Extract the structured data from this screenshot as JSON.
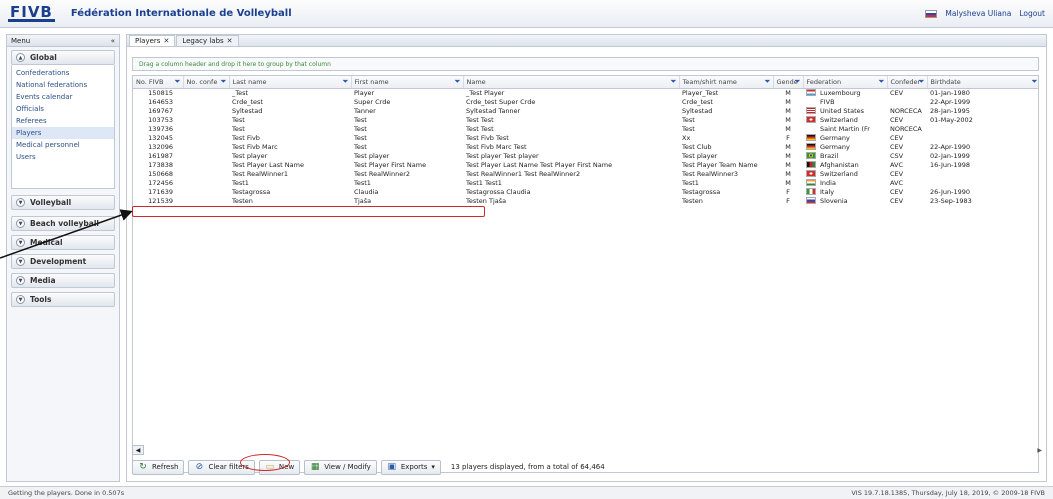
{
  "header": {
    "logo": "FIVB",
    "title": "Fédération Internationale de Volleyball",
    "user": "Malysheva Uliana",
    "logout": "Logout"
  },
  "sidebar": {
    "title": "Menu",
    "pin": "«",
    "global": {
      "label": "Global",
      "items": [
        "Confederations",
        "National federations",
        "Events calendar",
        "Officials",
        "Referees",
        "Players",
        "Medical personnel",
        "Users"
      ]
    },
    "sections": [
      "Volleyball",
      "Beach volleyball",
      "Medical",
      "Development",
      "Media",
      "Tools"
    ]
  },
  "tabs": [
    {
      "label": "Players"
    },
    {
      "label": "Legacy labs"
    }
  ],
  "group_bar": "Drag a column header and drop it here to group by that column",
  "columns": [
    "No. FIVB",
    "No. confe",
    "Last name",
    "First name",
    "Name",
    "Team/shirt name",
    "Gende",
    "Federation",
    "Confeder",
    "Birthdate"
  ],
  "rows": [
    {
      "no": "150815",
      "conf": "",
      "last": "_Test",
      "first": "Player",
      "name": "_Test Player",
      "team": "Player_Test",
      "gender": "M",
      "fed": "Luxembourg",
      "flag": "lux",
      "confed": "CEV",
      "birth": "01-Jan-1980"
    },
    {
      "no": "164653",
      "conf": "",
      "last": "Crde_test",
      "first": "Super Crde",
      "name": "Crde_test Super Crde",
      "team": "Crde_test",
      "gender": "M",
      "fed": "FIVB",
      "flag": "",
      "confed": "",
      "birth": "22-Apr-1999"
    },
    {
      "no": "169767",
      "conf": "",
      "last": "Syltestad",
      "first": "Tanner",
      "name": "Syltestad Tanner",
      "team": "Syltestad",
      "gender": "M",
      "fed": "United States",
      "flag": "usa",
      "confed": "NORCECA",
      "birth": "28-Jan-1995"
    },
    {
      "no": "103753",
      "conf": "",
      "last": "Test",
      "first": "Test",
      "name": "Test Test",
      "team": "Test",
      "gender": "M",
      "fed": "Switzerland",
      "flag": "sui",
      "confed": "CEV",
      "birth": "01-May-2002"
    },
    {
      "no": "139736",
      "conf": "",
      "last": "Test",
      "first": "Test",
      "name": "Test Test",
      "team": "Test",
      "gender": "M",
      "fed": "Saint Martin (Fr",
      "flag": "",
      "confed": "NORCECA",
      "birth": ""
    },
    {
      "no": "132045",
      "conf": "",
      "last": "Test Fivb",
      "first": "Test",
      "name": "Test Fivb Test",
      "team": "Xx",
      "gender": "F",
      "fed": "Germany",
      "flag": "ger",
      "confed": "CEV",
      "birth": ""
    },
    {
      "no": "132096",
      "conf": "",
      "last": "Test Fivb Marc",
      "first": "Test",
      "name": "Test Fivb Marc Test",
      "team": "Test Club",
      "gender": "M",
      "fed": "Germany",
      "flag": "ger",
      "confed": "CEV",
      "birth": "22-Apr-1990"
    },
    {
      "no": "161987",
      "conf": "",
      "last": "Test player",
      "first": "Test player",
      "name": "Test player Test player",
      "team": "Test player",
      "gender": "M",
      "fed": "Brazil",
      "flag": "bra",
      "confed": "CSV",
      "birth": "02-Jan-1999"
    },
    {
      "no": "173838",
      "conf": "",
      "last": "Test Player Last Name",
      "first": "Test Player First Name",
      "name": "Test Player Last Name Test Player First Name",
      "team": "Test Player Team Name",
      "gender": "M",
      "fed": "Afghanistan",
      "flag": "afg",
      "confed": "AVC",
      "birth": "16-Jun-1998"
    },
    {
      "no": "150668",
      "conf": "",
      "last": "Test RealWinner1",
      "first": "Test RealWinner2",
      "name": "Test RealWinner1 Test RealWinner2",
      "team": "Test RealWinner3",
      "gender": "M",
      "fed": "Switzerland",
      "flag": "sui",
      "confed": "CEV",
      "birth": ""
    },
    {
      "no": "172456",
      "conf": "",
      "last": "Test1",
      "first": "Test1",
      "name": "Test1 Test1",
      "team": "Test1",
      "gender": "M",
      "fed": "India",
      "flag": "ind",
      "confed": "AVC",
      "birth": ""
    },
    {
      "no": "171639",
      "conf": "",
      "last": "Testagrossa",
      "first": "Claudia",
      "name": "Testagrossa Claudia",
      "team": "Testagrossa",
      "gender": "F",
      "fed": "Italy",
      "flag": "ita",
      "confed": "CEV",
      "birth": "26-Jun-1990"
    },
    {
      "no": "121539",
      "conf": "",
      "last": "Testen",
      "first": "Tjaša",
      "name": "Testen Tjaša",
      "team": "Testen",
      "gender": "F",
      "fed": "Slovenia",
      "flag": "slo",
      "confed": "CEV",
      "birth": "23-Sep-1983"
    }
  ],
  "toolbar": {
    "refresh": "Refresh",
    "clear_filters": "Clear filters",
    "new": "New",
    "view_modify": "View / Modify",
    "exports": "Exports",
    "status": "13 players displayed, from a total of 64,464"
  },
  "statusbar": {
    "left": "Getting the players. Done in 0.507s",
    "right": "VIS 19.7.18.1385, Thursday, July 18, 2019, © 2009-18 FIVB"
  },
  "colors": {
    "brand": "#1b3f8f",
    "annotation": "#cc2b2b",
    "link": "#2a4f8a"
  }
}
